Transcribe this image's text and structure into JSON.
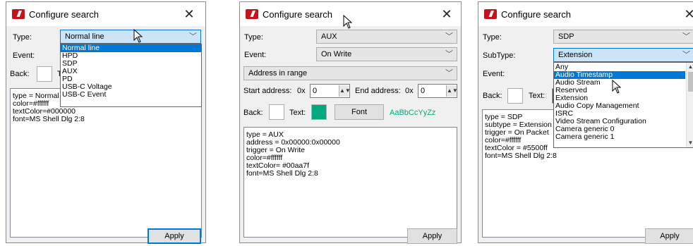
{
  "dialog1": {
    "title": "Configure search",
    "type_label": "Type:",
    "type_value": "Normal line",
    "event_label": "Event:",
    "back_label": "Back:",
    "text_label_partial": "T",
    "type_options": [
      "Normal line",
      "HPD",
      "SDP",
      "AUX",
      "PD",
      "USB-C Voltage",
      "USB-C Event"
    ],
    "selected_option": "Normal line",
    "info_lines": [
      "type = Normal line",
      "color=#ffffff",
      "textColor=#000000",
      "font=MS Shell Dlg 2:8"
    ],
    "apply_label": "Apply",
    "back_color": "#ffffff"
  },
  "dialog2": {
    "title": "Configure search",
    "type_label": "Type:",
    "type_value": "AUX",
    "event_label": "Event:",
    "event_value": "On Write",
    "range_value": "Address in range",
    "start_label": "Start address:",
    "start_prefix": "0x",
    "start_value": "0",
    "end_label": "End address:",
    "end_prefix": "0x",
    "end_value": "0",
    "back_label": "Back:",
    "text_label": "Text:",
    "font_button": "Font",
    "font_preview": "AaBbCcYyZz",
    "back_color": "#ffffff",
    "text_color": "#00aa7f",
    "info_lines": [
      "type = AUX",
      "address = 0x00000:0x00000",
      "trigger = On Write",
      "color=#ffffff",
      "textColor= #00aa7f",
      "font=MS Shell Dlg 2:8"
    ],
    "apply_label": "Apply"
  },
  "dialog3": {
    "title": "Configure search",
    "type_label": "Type:",
    "type_value": "SDP",
    "subtype_label": "SubType:",
    "subtype_value": "Extension",
    "event_label": "Event:",
    "back_label": "Back:",
    "text_label": "Text:",
    "back_color": "#ffffff",
    "text_color": "#5500ff",
    "subtype_options": [
      "Any",
      "Audio Timestamp",
      "Audio Stream",
      "Reserved",
      "Extension",
      "Audio Copy Management",
      "ISRC",
      "Video Stream Configuration",
      "Camera generic 0",
      "Camera generic 1"
    ],
    "highlighted_option": "Audio Timestamp",
    "info_lines": [
      "type = SDP",
      "subtype = Extension",
      "trigger = On Packet",
      "color=#ffffff",
      "textColor = #5500ff",
      "font=MS Shell Dlg 2:8"
    ],
    "apply_label": "Apply"
  },
  "icons": {
    "app": "app-logo-icon",
    "close": "close-icon",
    "chevron": "chevron-down-icon",
    "cursor": "mouse-pointer-icon",
    "spin": "spin-arrows-icon"
  },
  "colors": {
    "selection": "#0078d7",
    "app_logo": "#c4141b",
    "dialog_bg": "#f0f0f0"
  }
}
